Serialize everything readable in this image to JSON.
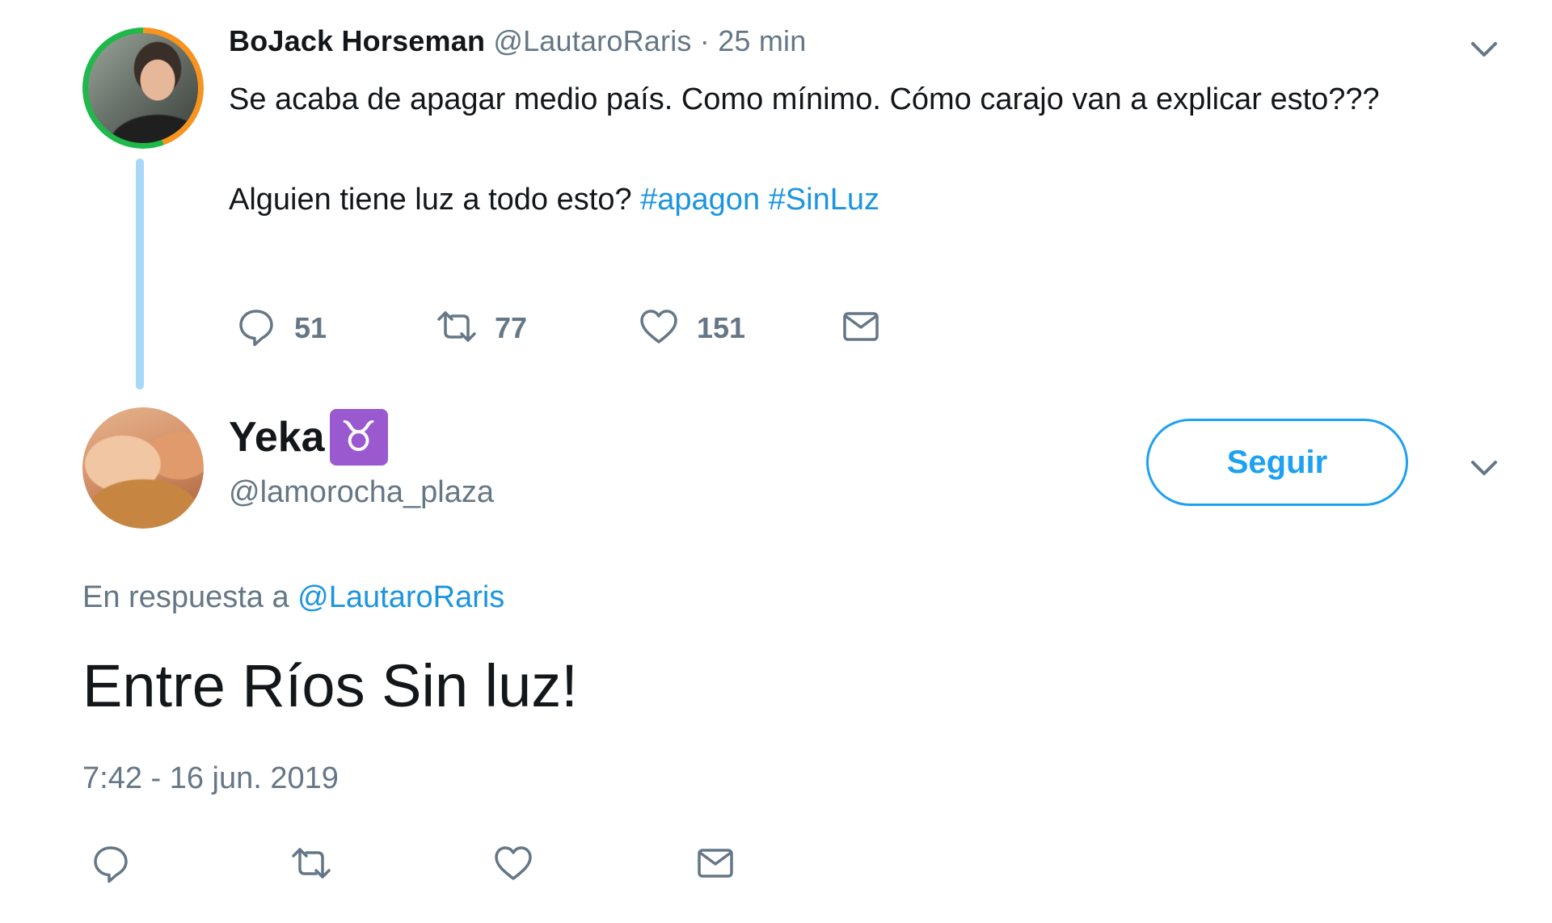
{
  "parent_tweet": {
    "display_name": "BoJack Horseman",
    "handle": "@LautaroRaris",
    "separator": "·",
    "time_ago": "25 min",
    "text_line1": "Se acaba de apagar medio país. Como mínimo. Cómo carajo van a explicar esto???",
    "text_line2_prefix": "Alguien tiene luz a todo esto? ",
    "hashtags": [
      "#apagon",
      "#SinLuz"
    ],
    "reply_count": "51",
    "retweet_count": "77",
    "like_count": "151"
  },
  "reply_tweet": {
    "display_name": "Yeka",
    "name_emoji": "♉",
    "handle": "@lamorocha_plaza",
    "follow_label": "Seguir",
    "in_reply_to_label": "En respuesta a",
    "in_reply_to_handle": "@LautaroRaris",
    "text": "Entre Ríos Sin luz!",
    "timestamp": "7:42 - 16 jun. 2019"
  },
  "icons": [
    "reply-icon",
    "retweet-icon",
    "like-icon",
    "message-icon",
    "chevron-down-icon"
  ],
  "colors": {
    "link": "#1b95e0",
    "follow_border": "#1da1f2",
    "secondary_text": "#657786",
    "thread_line": "#a8d8f8"
  }
}
